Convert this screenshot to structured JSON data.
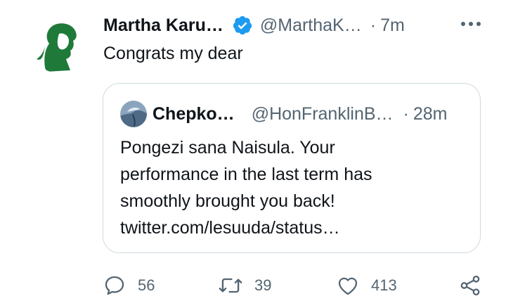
{
  "tweet": {
    "author_name": "Martha Karu…",
    "verified": true,
    "handle": "@MarthaK…",
    "separator": "·",
    "time": "7m",
    "text": "Congrats my dear"
  },
  "quoted_tweet": {
    "author_name": "Chepko…",
    "handle": "@HonFranklinB…",
    "separator": "·",
    "time": "28m",
    "lines": [
      "Pongezi sana Naisula. Your",
      "performance in the last term has",
      "smoothly brought you back!",
      "twitter.com/lesuuda/status…"
    ]
  },
  "actions": {
    "replies": "56",
    "retweets": "39",
    "likes": "413"
  },
  "colors": {
    "text_primary": "#0f1419",
    "text_secondary": "#536471",
    "verified_blue": "#1d9bf0",
    "avatar_green": "#1f7a3a",
    "border": "#cfd9de"
  },
  "icons": [
    "verified-badge-icon",
    "more-icon",
    "reply-icon",
    "retweet-icon",
    "like-icon",
    "share-icon"
  ]
}
